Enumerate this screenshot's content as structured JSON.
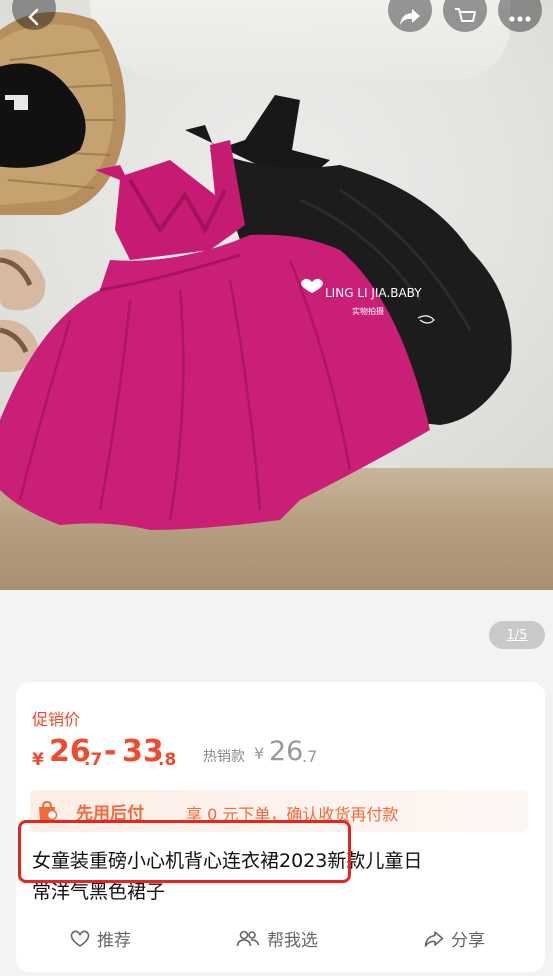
{
  "gallery": {
    "counter": "1/5",
    "watermark_brand": "LING LI JIA.BABY",
    "watermark_sub": "实物拍摄"
  },
  "top_bar": {
    "back_icon": "chevron-left-icon",
    "share_icon": "share-arrow-icon",
    "cart_icon": "cart-icon",
    "more_icon": "more-dots-icon"
  },
  "price": {
    "label": "促销价",
    "currency": "¥",
    "low_int": "26",
    "low_dec": ".7",
    "dash": "-",
    "high_int": "33",
    "high_dec": ".8",
    "hot_label": "热销款",
    "hot_currency": "¥",
    "hot_int": "26",
    "hot_dec": ".7"
  },
  "pay_after": {
    "title": "先用后付",
    "desc": "享 0 元下单，确认收货再付款"
  },
  "product": {
    "title_line1": "女童装重磅小心机背心连衣裙2023新款儿童日",
    "title_line2": "常洋气黑色裙子"
  },
  "actions": {
    "recommend": "推荐",
    "help_choose": "帮我选",
    "share": "分享"
  },
  "colors": {
    "accent": "#f04a2e",
    "highlight_box": "#e8251c"
  }
}
